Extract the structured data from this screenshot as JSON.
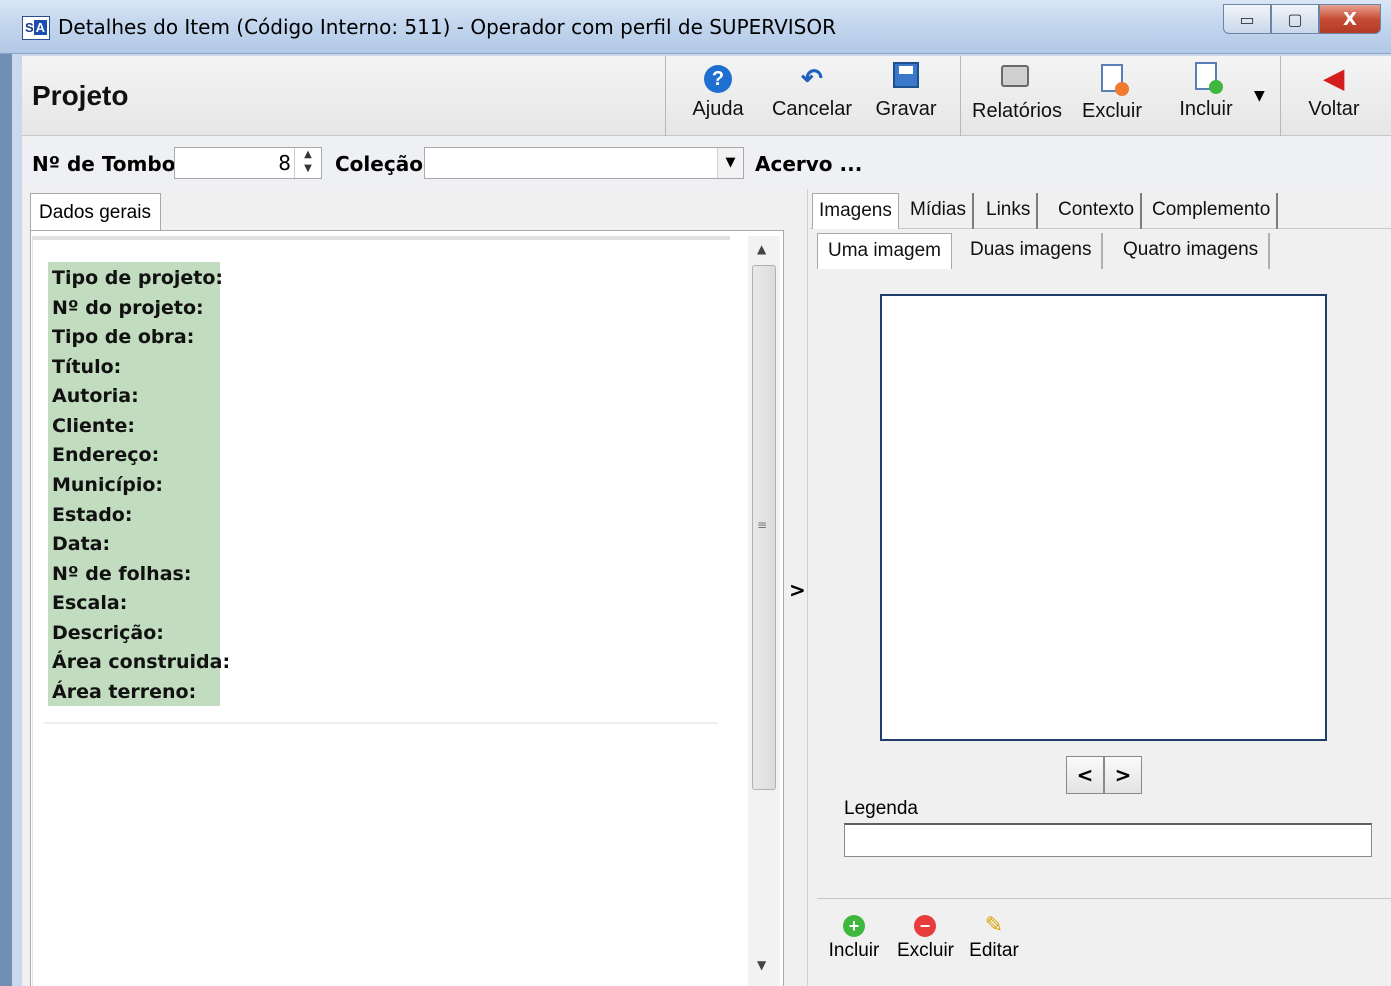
{
  "window": {
    "title": "Detalhes do Item (Código Interno: 511) - Operador com perfil de SUPERVISOR",
    "app_icon_left": "S",
    "app_icon_right": "A",
    "minimize": "▭",
    "maximize": "▢",
    "close": "X"
  },
  "toolbar": {
    "page_title": "Projeto",
    "ajuda": "Ajuda",
    "cancelar": "Cancelar",
    "gravar": "Gravar",
    "relatorios": "Relatórios",
    "excluir": "Excluir",
    "incluir": "Incluir",
    "voltar": "Voltar",
    "dropdown_arrow": "▼",
    "help_glyph": "?",
    "undo_glyph": "↶",
    "back_glyph": "◀"
  },
  "tombo": {
    "label": "Nº de Tombo",
    "value": "8",
    "colecao_label": "Coleção",
    "colecao_value": "",
    "acervo_label": "Acervo ...",
    "spin_up": "▲",
    "spin_down": "▼",
    "combo_arrow": "▼"
  },
  "left_panel": {
    "tab": "Dados gerais",
    "fields": [
      "Tipo de projeto:",
      "Nº do projeto:",
      "Tipo de obra:",
      "Título:",
      "Autoria:",
      "Cliente:",
      "Endereço:",
      "Município:",
      "Estado:",
      "Data:",
      "Nº de folhas:",
      "Escala:",
      "Descrição:",
      "Área construida:",
      "Área terreno:"
    ],
    "scroll_up": "▲",
    "scroll_down": "▼",
    "grip": "≡",
    "splitter": ">"
  },
  "right_panel": {
    "tabs": [
      "Imagens",
      "Mídias",
      "Links",
      "Contexto",
      "Complemento"
    ],
    "subtabs": [
      "Uma imagem",
      "Duas imagens",
      "Quatro imagens"
    ],
    "prev": "<",
    "next": ">",
    "legenda_label": "Legenda",
    "legenda_value": "",
    "incluir": "Incluir",
    "excluir": "Excluir",
    "editar": "Editar",
    "plus_glyph": "+",
    "minus_glyph": "−",
    "pencil_glyph": "✎"
  },
  "colors": {
    "field_block": "#c1dcbe",
    "image_border": "#1f3d68",
    "titlebar": "#c3d6ee"
  }
}
